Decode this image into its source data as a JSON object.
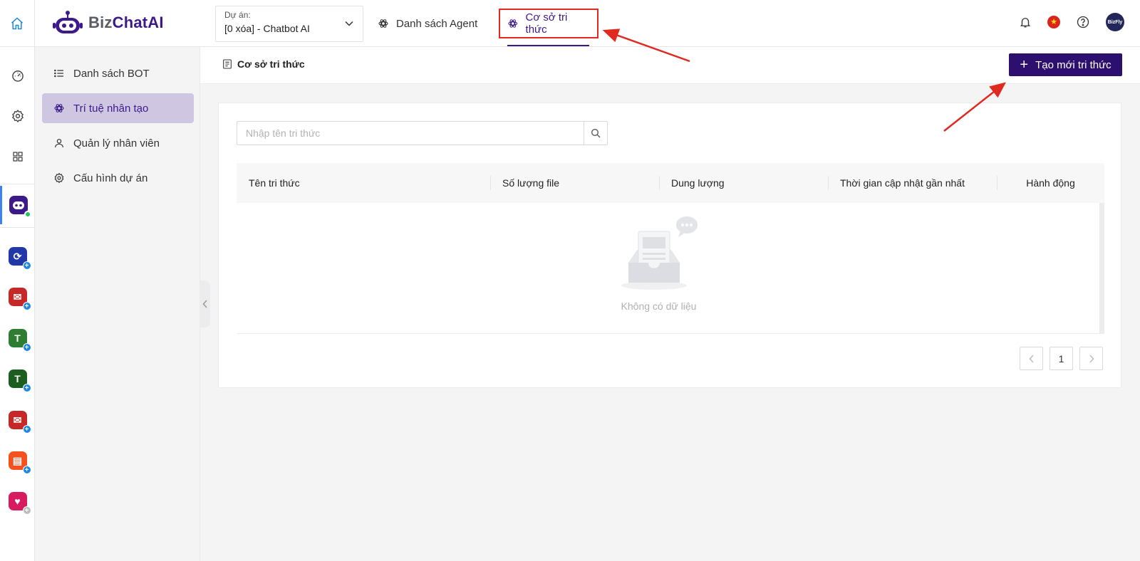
{
  "brand": {
    "name_part1": "Biz",
    "name_part2": "ChatAI"
  },
  "project": {
    "label": "Dự án:",
    "value": "[0 xóa] - Chatbot AI"
  },
  "top_tabs": [
    {
      "label": "Danh sách Agent",
      "icon": "openai-icon"
    },
    {
      "label": "Cơ sở tri thức",
      "icon": "openai-icon",
      "active": true
    }
  ],
  "top_icons": [
    "bell-icon",
    "vietnam-flag-icon",
    "help-icon",
    "user-avatar"
  ],
  "avatar_text": "BizFly",
  "rail": {
    "tools": [
      "dashboard-icon",
      "settings-icon",
      "apps-grid-icon"
    ],
    "active_app": "bizchatai-app",
    "apps": [
      {
        "name": "refresh-app",
        "color": "#2338a8"
      },
      {
        "name": "mail-app",
        "color": "#c62828"
      },
      {
        "name": "t-app",
        "color": "#2e7d32"
      },
      {
        "name": "t-app-2",
        "color": "#1b5e20"
      },
      {
        "name": "mail-app-2",
        "color": "#c62828"
      },
      {
        "name": "shopping-bag-app",
        "color": "#f4511e"
      },
      {
        "name": "heart-app",
        "color": "#d81b60"
      }
    ]
  },
  "sidebar": {
    "items": [
      {
        "label": "Danh sách BOT",
        "icon": "list-icon"
      },
      {
        "label": "Trí tuệ nhân tạo",
        "icon": "openai-icon",
        "active": true
      },
      {
        "label": "Quản lý nhân viên",
        "icon": "user-icon"
      },
      {
        "label": "Cấu hình dự án",
        "icon": "gear-icon"
      }
    ]
  },
  "main": {
    "breadcrumb": "Cơ sở tri thức",
    "create_button": "Tạo mới tri thức",
    "search_placeholder": "Nhập tên tri thức",
    "columns": [
      "Tên tri thức",
      "Số lượng file",
      "Dung lượng",
      "Thời gian cập nhật gần nhất",
      "Hành động"
    ],
    "rows": [],
    "empty_text": "Không có dữ liệu",
    "pagination": {
      "current_page": "1"
    }
  },
  "colors": {
    "brand": "#2d0f6f",
    "accent_purple": "#3d1a8c",
    "annotation_red": "#e0291f",
    "active_sidebar": "#cfc7e2"
  }
}
